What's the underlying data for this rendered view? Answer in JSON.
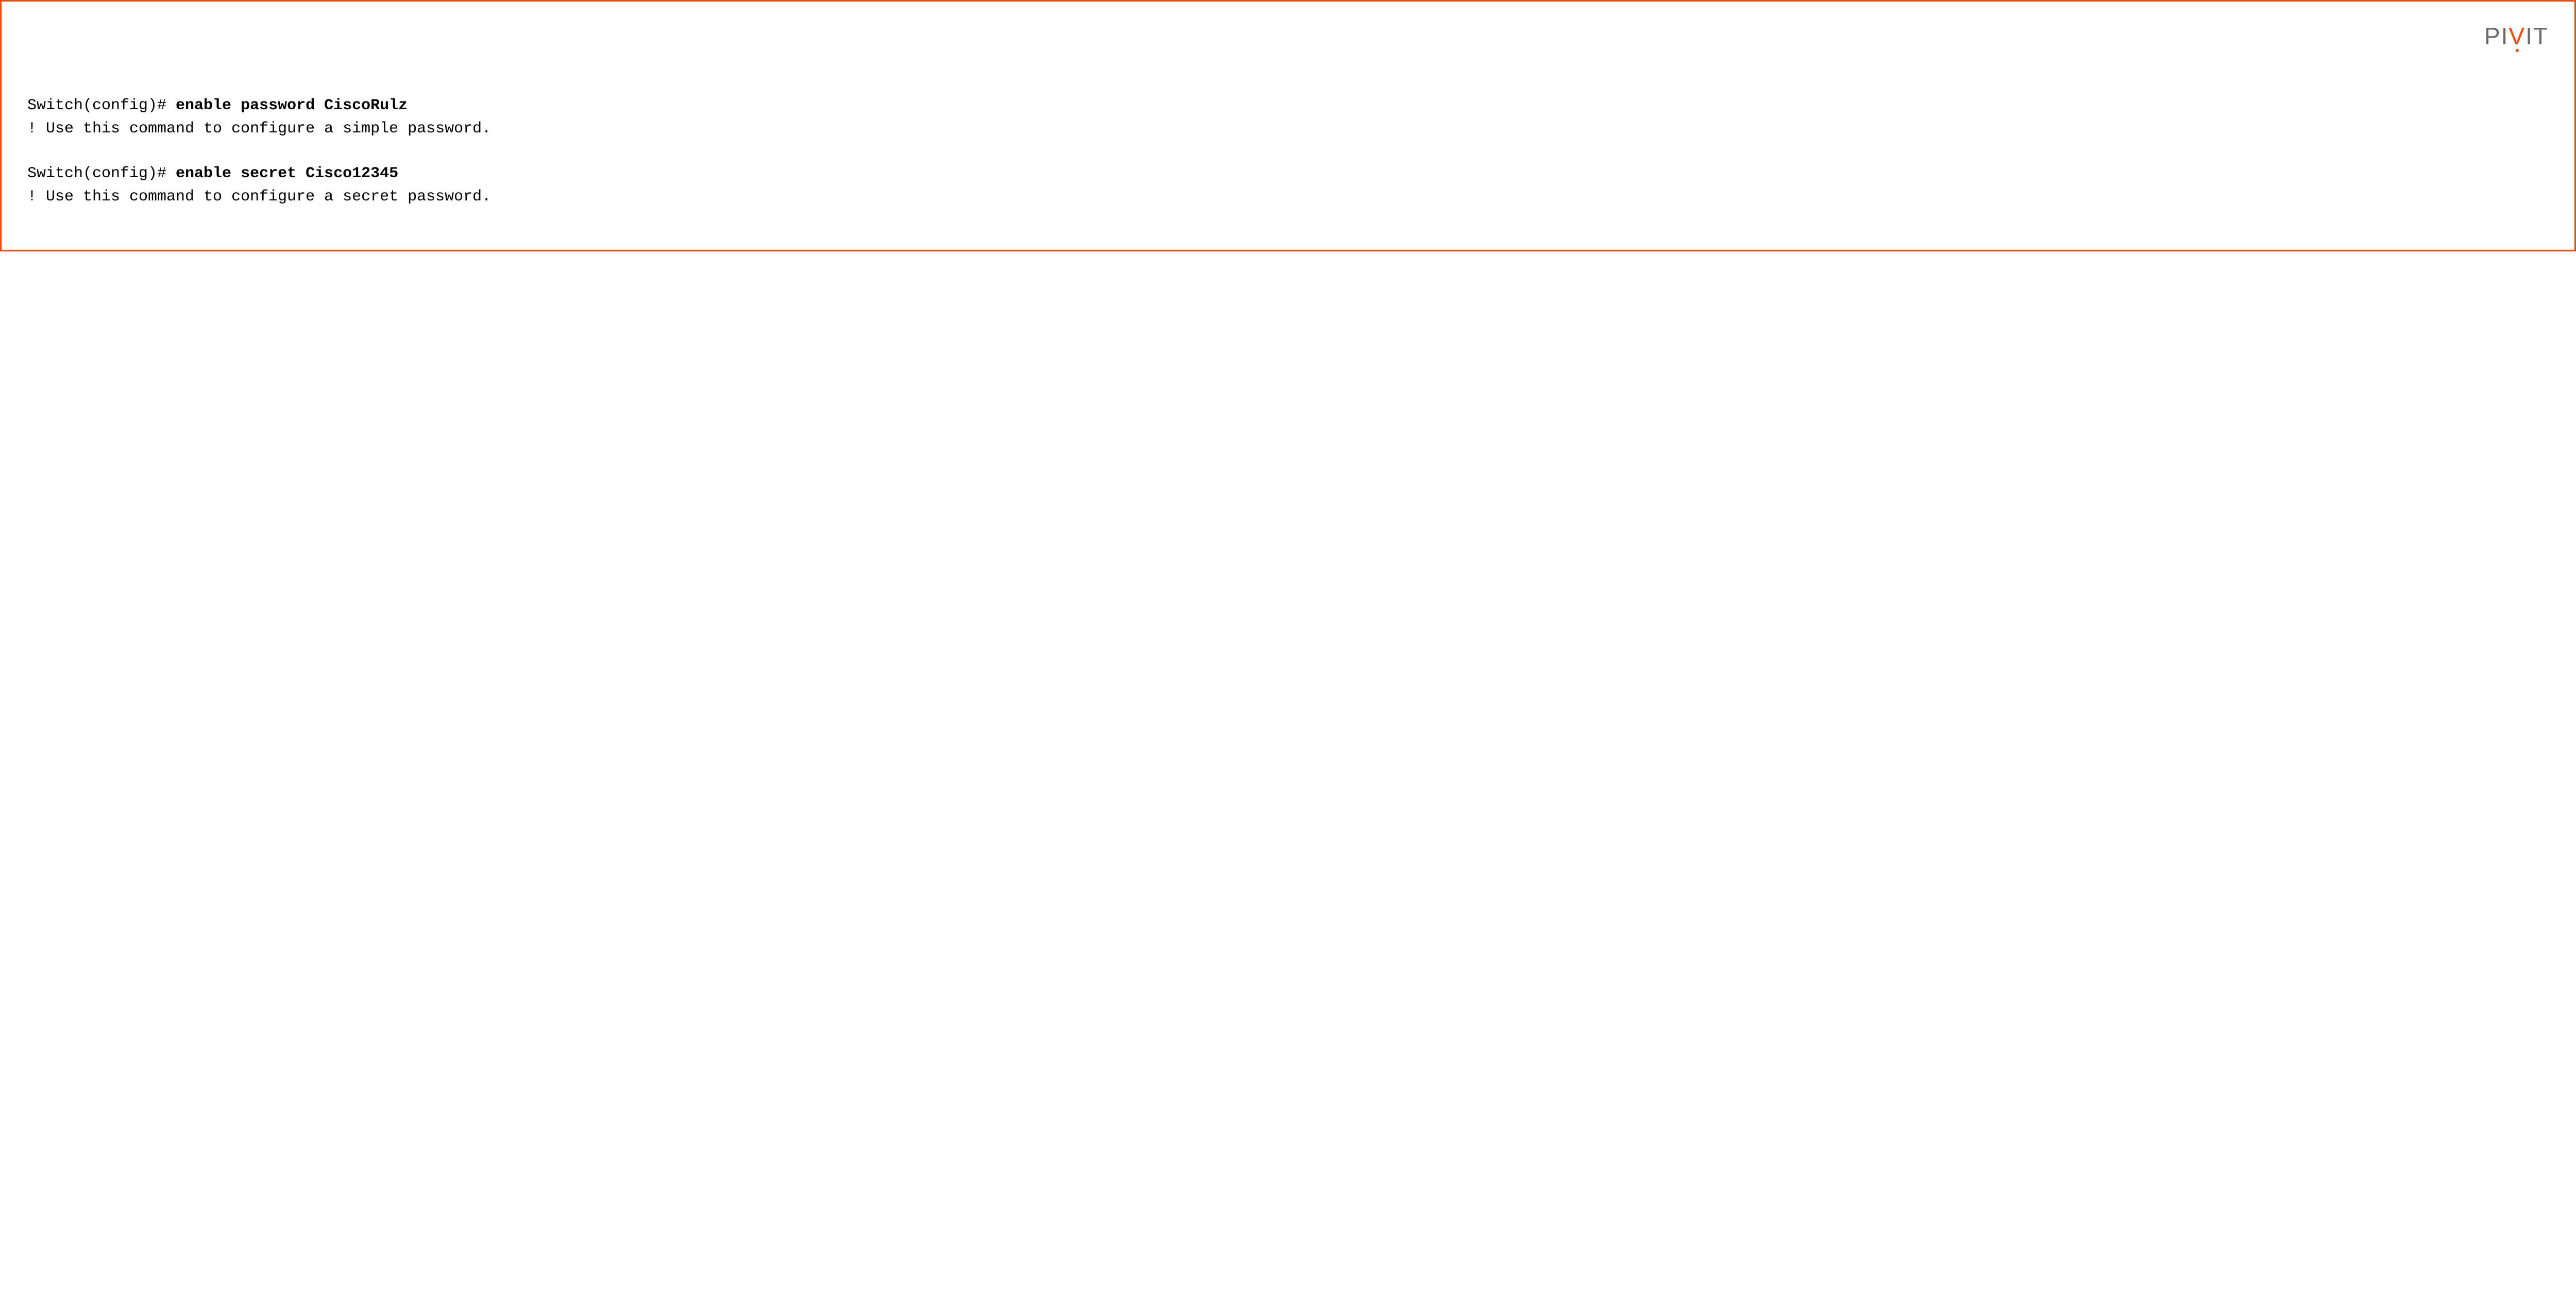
{
  "logo": {
    "p": "P",
    "i1": "I",
    "v": "V",
    "i2": "I",
    "t": "T"
  },
  "terminal": {
    "block1": {
      "prompt": "Switch(config)# ",
      "command": "enable password CiscoRulz",
      "comment": "! Use this command to configure a simple password."
    },
    "block2": {
      "prompt": "Switch(config)# ",
      "command": "enable secret Cisco12345",
      "comment": "! Use this command to configure a secret password."
    }
  }
}
